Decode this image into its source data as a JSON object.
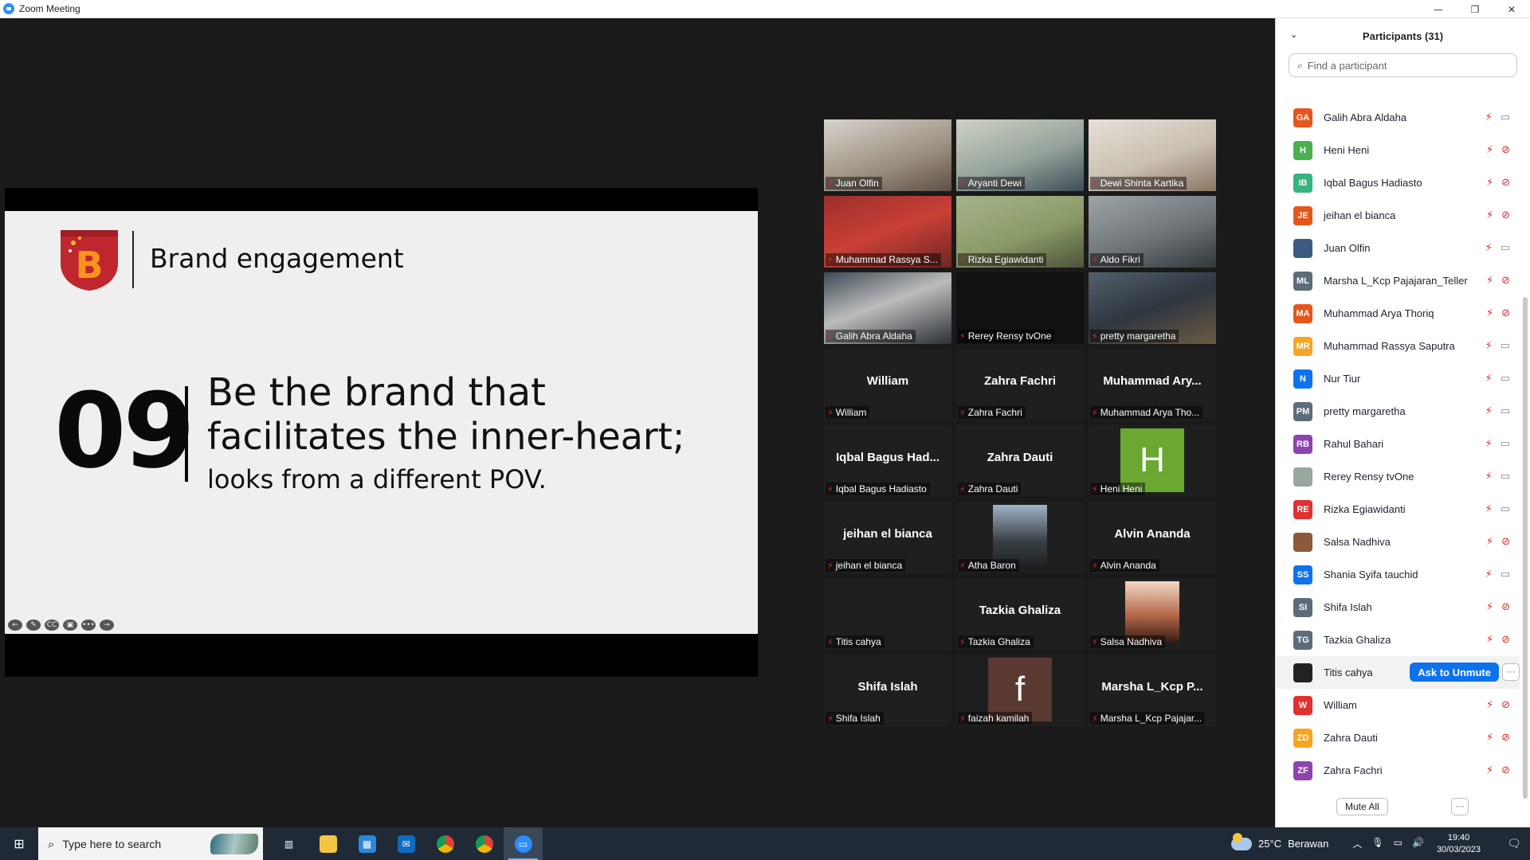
{
  "window": {
    "title": "Zoom Meeting",
    "buttons": [
      "—",
      "❐",
      "✕"
    ]
  },
  "slide": {
    "heading": "Brand engagement",
    "number": "09",
    "line1": "Be the brand that",
    "line2": "facilitates the inner-heart;",
    "line3": "looks from a different POV.",
    "logo_letter": "B",
    "tools": [
      "←",
      "✎",
      "CC",
      "▣",
      "•••",
      "→"
    ]
  },
  "gallery": [
    {
      "label": "Juan Olfin",
      "style": "v1",
      "center": ""
    },
    {
      "label": "Aryanti Dewi",
      "style": "v2",
      "center": ""
    },
    {
      "label": "Dewi Shinta Kartika",
      "style": "v3",
      "center": ""
    },
    {
      "label": "Muhammad Rassya S...",
      "style": "v4",
      "center": ""
    },
    {
      "label": "Rizka Egiawidanti",
      "style": "v5",
      "center": ""
    },
    {
      "label": "Aldo Fikri",
      "style": "v6",
      "center": ""
    },
    {
      "label": "Galih Abra Aldaha",
      "style": "v7",
      "center": ""
    },
    {
      "label": "Rerey Rensy tvOne",
      "style": "v8",
      "center": ""
    },
    {
      "label": "pretty margaretha",
      "style": "v9",
      "center": ""
    },
    {
      "label": "William",
      "style": "name",
      "center": "William"
    },
    {
      "label": "Zahra Fachri",
      "style": "name",
      "center": "Zahra Fachri"
    },
    {
      "label": "Muhammad Arya Tho...",
      "style": "name",
      "center": "Muhammad Ary..."
    },
    {
      "label": "Iqbal Bagus Hadiasto",
      "style": "name",
      "center": "Iqbal Bagus Had..."
    },
    {
      "label": "Zahra Dauti",
      "style": "name",
      "center": "Zahra Dauti"
    },
    {
      "label": "Heni Heni",
      "style": "letter",
      "center": "H",
      "color": "#6aa832"
    },
    {
      "label": "jeihan el bianca",
      "style": "name",
      "center": "jeihan el bianca"
    },
    {
      "label": "Atha Baron",
      "style": "photo",
      "center": ""
    },
    {
      "label": "Alvin Ananda",
      "style": "name",
      "center": "Alvin Ananda"
    },
    {
      "label": "Titis cahya",
      "style": "blank",
      "center": ""
    },
    {
      "label": "Tazkia Ghaliza",
      "style": "name",
      "center": "Tazkia Ghaliza"
    },
    {
      "label": "Salsa Nadhiva",
      "style": "photo2",
      "center": ""
    },
    {
      "label": "Shifa Islah",
      "style": "name",
      "center": "Shifa Islah"
    },
    {
      "label": "faizah kamilah",
      "style": "letter",
      "center": "f",
      "color": "#5a3a32"
    },
    {
      "label": "Marsha L_Kcp Pajajar...",
      "style": "name",
      "center": "Marsha L_Kcp P..."
    }
  ],
  "panel": {
    "title": "Participants (31)",
    "search_placeholder": "Find a participant",
    "mute_all": "Mute All",
    "more": "···",
    "ask_to_unmute": "Ask to Unmute"
  },
  "participants": [
    {
      "initials": "GA",
      "name": "Galih Abra Aldaha",
      "color": "#e5561d",
      "cam": "on"
    },
    {
      "initials": "H",
      "name": "Heni Heni",
      "color": "#4caf50",
      "cam": "off"
    },
    {
      "initials": "IB",
      "name": "Iqbal Bagus Hadiasto",
      "color": "#36b37e",
      "cam": "off"
    },
    {
      "initials": "JE",
      "name": "jeihan el bianca",
      "color": "#e5561d",
      "cam": "off"
    },
    {
      "initials": "",
      "name": "Juan Olfin",
      "color": "#3c5a80",
      "cam": "on"
    },
    {
      "initials": "ML",
      "name": "Marsha L_Kcp Pajajaran_Teller",
      "color": "#5e6b7a",
      "cam": "off"
    },
    {
      "initials": "MA",
      "name": "Muhammad Arya Thoriq",
      "color": "#e5561d",
      "cam": "off"
    },
    {
      "initials": "MR",
      "name": "Muhammad Rassya Saputra",
      "color": "#f5a623",
      "cam": "on"
    },
    {
      "initials": "N",
      "name": "Nur Tiur",
      "color": "#0e72ed",
      "cam": "on"
    },
    {
      "initials": "PM",
      "name": "pretty margaretha",
      "color": "#5e6b7a",
      "cam": "on"
    },
    {
      "initials": "RB",
      "name": "Rahul Bahari",
      "color": "#8e44ad",
      "cam": "on"
    },
    {
      "initials": "",
      "name": "Rerey Rensy tvOne",
      "color": "#9aa7a0",
      "cam": "on"
    },
    {
      "initials": "RE",
      "name": "Rizka Egiawidanti",
      "color": "#e03131",
      "cam": "on"
    },
    {
      "initials": "",
      "name": "Salsa Nadhiva",
      "color": "#8b5a3c",
      "cam": "off"
    },
    {
      "initials": "SS",
      "name": "Shania Syifa tauchid",
      "color": "#0e72ed",
      "cam": "on"
    },
    {
      "initials": "SI",
      "name": "Shifa Islah",
      "color": "#5e6b7a",
      "cam": "off"
    },
    {
      "initials": "TG",
      "name": "Tazkia Ghaliza",
      "color": "#5e6b7a",
      "cam": "off"
    },
    {
      "initials": "",
      "name": "Titis cahya",
      "color": "#222222",
      "cam": "ask"
    },
    {
      "initials": "W",
      "name": "William",
      "color": "#e03131",
      "cam": "off"
    },
    {
      "initials": "ZD",
      "name": "Zahra Dauti",
      "color": "#f5a623",
      "cam": "off"
    },
    {
      "initials": "ZF",
      "name": "Zahra Fachri",
      "color": "#8e44ad",
      "cam": "off"
    }
  ],
  "taskbar": {
    "search_placeholder": "Type here to search",
    "weather_temp": "25°C",
    "weather_text": "Berawan",
    "time": "19:40",
    "date": "30/03/2023"
  }
}
